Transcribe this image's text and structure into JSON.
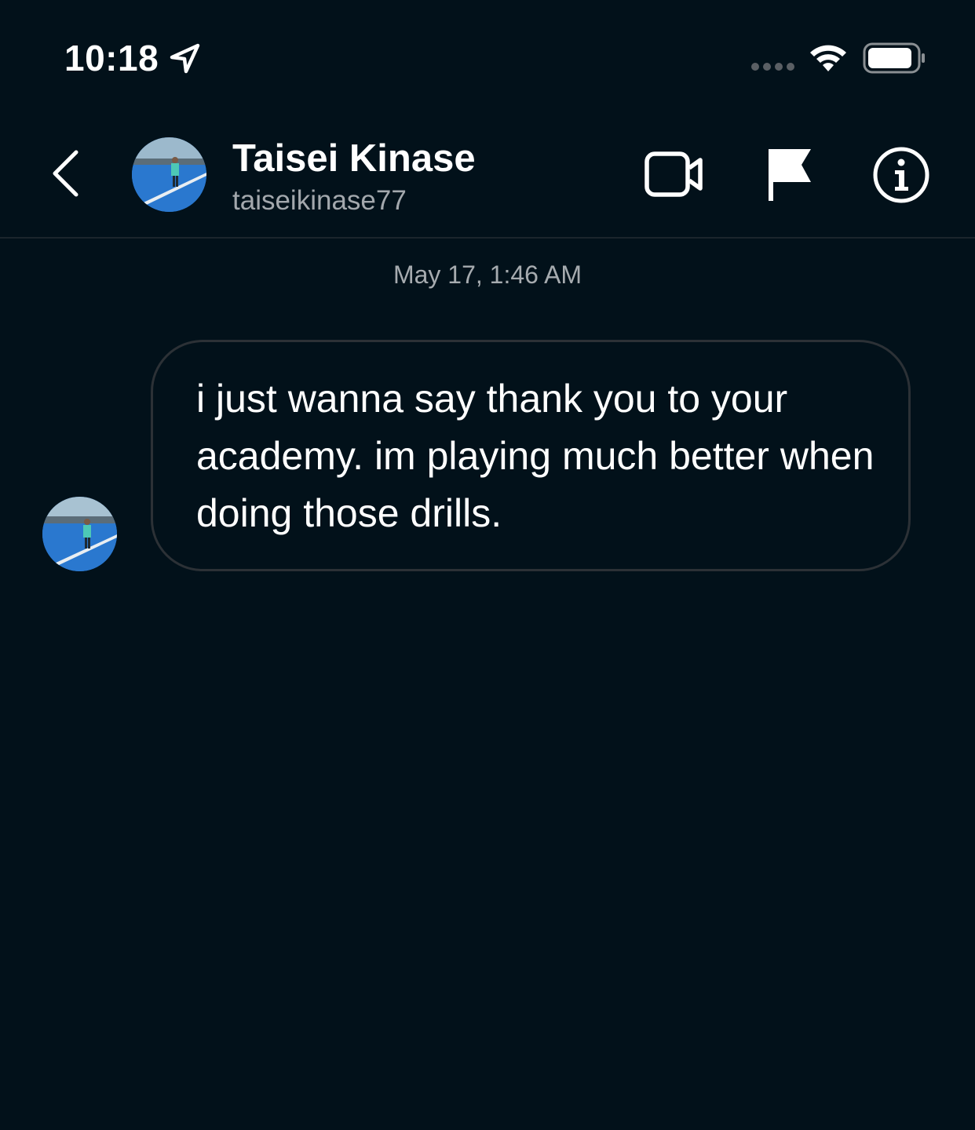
{
  "status_bar": {
    "time": "10:18",
    "icons": [
      "location-arrow-icon",
      "signal-dots-icon",
      "wifi-icon",
      "battery-icon"
    ]
  },
  "header": {
    "back_icon": "chevron-left-icon",
    "contact_name": "Taisei Kinase",
    "contact_username": "taiseikinase77",
    "actions": [
      "video-call-icon",
      "flag-icon",
      "info-icon"
    ]
  },
  "conversation": {
    "timestamp": "May 17, 1:46 AM",
    "messages": [
      {
        "sender": "Taisei Kinase",
        "text": "i just wanna say thank you to your academy. im playing much better when doing those drills."
      }
    ]
  },
  "colors": {
    "background": "#02111a",
    "bubble_border": "#2c3136",
    "secondary_text": "#a3a8ad",
    "avatar_court_blue": "#2f7fd3"
  }
}
